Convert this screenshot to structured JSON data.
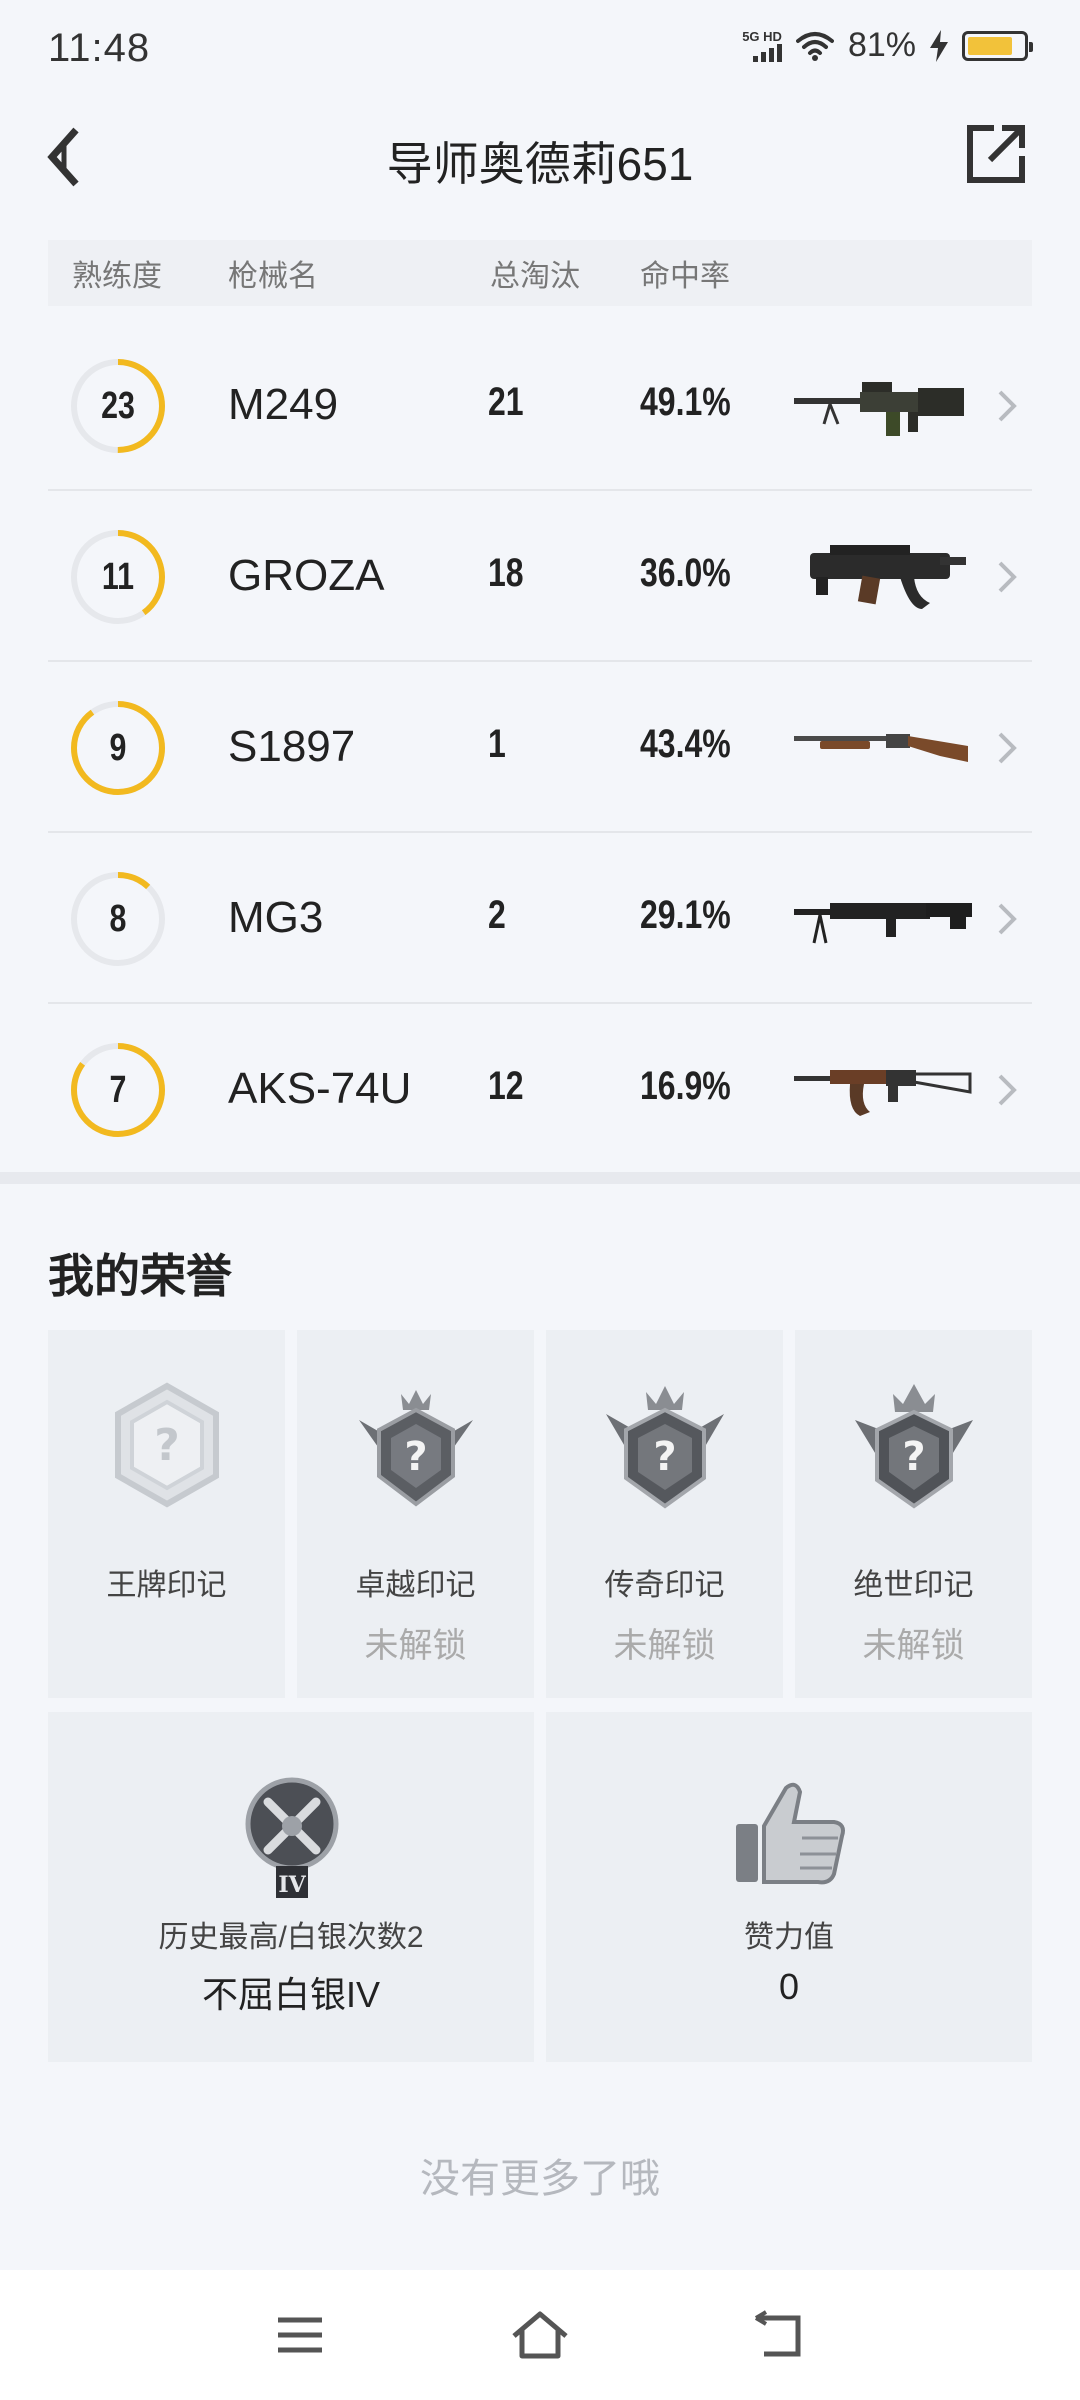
{
  "status": {
    "time": "11:48",
    "network": "5G HD",
    "battery": "81%",
    "battery_level": 0.81
  },
  "header": {
    "title": "导师奥德莉651"
  },
  "table": {
    "headers": {
      "proficiency": "熟练度",
      "gun_name": "枪械名",
      "kills": "总淘汰",
      "accuracy": "命中率"
    },
    "rows": [
      {
        "level": "23",
        "name": "M249",
        "kills": "21",
        "accuracy": "49.1%",
        "progress": 0.5,
        "gun_icon": "lmg-icon"
      },
      {
        "level": "11",
        "name": "GROZA",
        "kills": "18",
        "accuracy": "36.0%",
        "progress": 0.4,
        "gun_icon": "bullpup-rifle-icon"
      },
      {
        "level": "9",
        "name": "S1897",
        "kills": "1",
        "accuracy": "43.4%",
        "progress": 0.9,
        "gun_icon": "shotgun-icon"
      },
      {
        "level": "8",
        "name": "MG3",
        "kills": "2",
        "accuracy": "29.1%",
        "progress": 0.12,
        "gun_icon": "machine-gun-icon"
      },
      {
        "level": "7",
        "name": "AKS-74U",
        "kills": "12",
        "accuracy": "16.9%",
        "progress": 0.85,
        "gun_icon": "carbine-icon"
      }
    ]
  },
  "honors": {
    "title": "我的荣誉",
    "marks": [
      {
        "label": "王牌印记",
        "status": ""
      },
      {
        "label": "卓越印记",
        "status": "未解锁"
      },
      {
        "label": "传奇印记",
        "status": "未解锁"
      },
      {
        "label": "绝世印记",
        "status": "未解锁"
      }
    ],
    "rank": {
      "label": "历史最高/白银次数2",
      "value": "不屈白银IV",
      "badge_text": "IV"
    },
    "likes": {
      "label": "赞力值",
      "value": "0"
    }
  },
  "footer": {
    "no_more": "没有更多了哦"
  },
  "colors": {
    "accent": "#f2b91f",
    "background": "#f4f6fa",
    "card": "#eceff3"
  }
}
